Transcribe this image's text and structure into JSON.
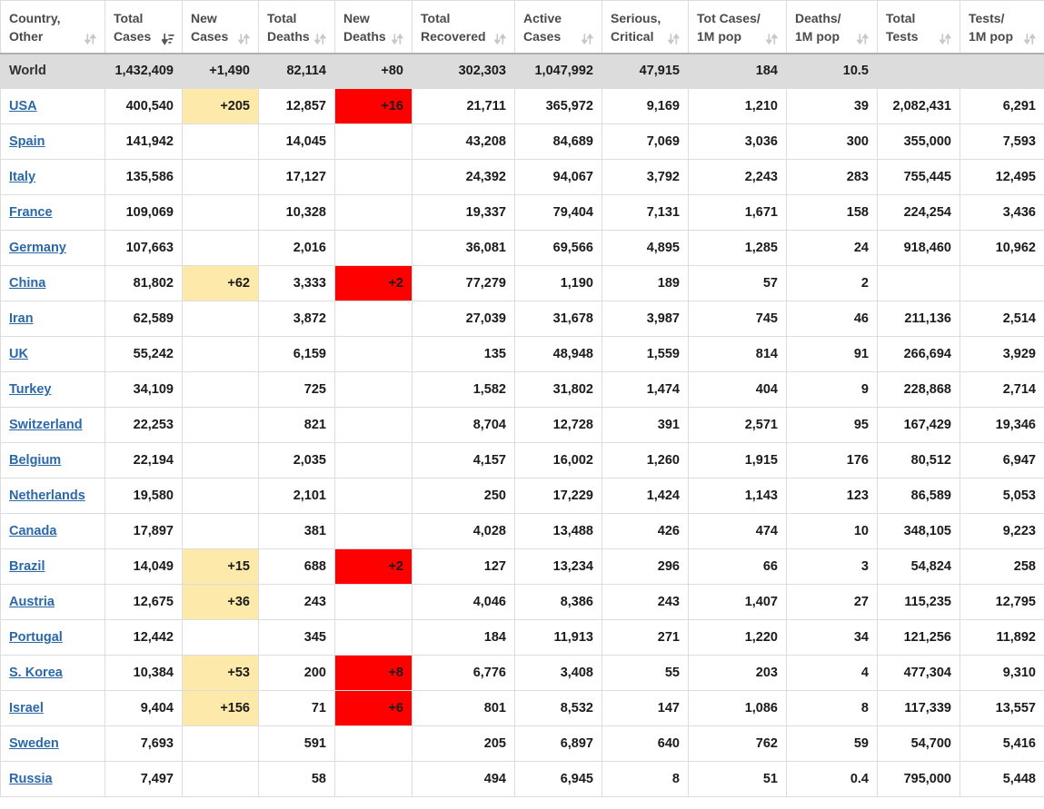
{
  "table": {
    "columns": [
      {
        "label_line1": "Country,",
        "label_line2": "Other",
        "sort": "both",
        "key": "country"
      },
      {
        "label_line1": "Total",
        "label_line2": "Cases",
        "sort": "desc",
        "key": "total_cases"
      },
      {
        "label_line1": "New",
        "label_line2": "Cases",
        "sort": "both",
        "key": "new_cases"
      },
      {
        "label_line1": "Total",
        "label_line2": "Deaths",
        "sort": "both",
        "key": "total_deaths"
      },
      {
        "label_line1": "New",
        "label_line2": "Deaths",
        "sort": "both",
        "key": "new_deaths"
      },
      {
        "label_line1": "Total",
        "label_line2": "Recovered",
        "sort": "both",
        "key": "total_recovered"
      },
      {
        "label_line1": "Active",
        "label_line2": "Cases",
        "sort": "both",
        "key": "active_cases"
      },
      {
        "label_line1": "Serious,",
        "label_line2": "Critical",
        "sort": "both",
        "key": "serious_critical"
      },
      {
        "label_line1": "Tot Cases/",
        "label_line2": "1M pop",
        "sort": "both",
        "key": "tot_cases_per_1m"
      },
      {
        "label_line1": "Deaths/",
        "label_line2": "1M pop",
        "sort": "both",
        "key": "deaths_per_1m"
      },
      {
        "label_line1": "Total",
        "label_line2": "Tests",
        "sort": "both",
        "key": "total_tests"
      },
      {
        "label_line1": "Tests/",
        "label_line2": "1M pop",
        "sort": "both",
        "key": "tests_per_1m"
      }
    ],
    "world_row": {
      "country": "World",
      "total_cases": "1,432,409",
      "new_cases": "+1,490",
      "total_deaths": "82,114",
      "new_deaths": "+80",
      "total_recovered": "302,303",
      "active_cases": "1,047,992",
      "serious_critical": "47,915",
      "tot_cases_per_1m": "184",
      "deaths_per_1m": "10.5",
      "total_tests": "",
      "tests_per_1m": ""
    },
    "rows": [
      {
        "country": "USA",
        "total_cases": "400,540",
        "new_cases": "+205",
        "total_deaths": "12,857",
        "new_deaths": "+16",
        "total_recovered": "21,711",
        "active_cases": "365,972",
        "serious_critical": "9,169",
        "tot_cases_per_1m": "1,210",
        "deaths_per_1m": "39",
        "total_tests": "2,082,431",
        "tests_per_1m": "6,291"
      },
      {
        "country": "Spain",
        "total_cases": "141,942",
        "new_cases": "",
        "total_deaths": "14,045",
        "new_deaths": "",
        "total_recovered": "43,208",
        "active_cases": "84,689",
        "serious_critical": "7,069",
        "tot_cases_per_1m": "3,036",
        "deaths_per_1m": "300",
        "total_tests": "355,000",
        "tests_per_1m": "7,593"
      },
      {
        "country": "Italy",
        "total_cases": "135,586",
        "new_cases": "",
        "total_deaths": "17,127",
        "new_deaths": "",
        "total_recovered": "24,392",
        "active_cases": "94,067",
        "serious_critical": "3,792",
        "tot_cases_per_1m": "2,243",
        "deaths_per_1m": "283",
        "total_tests": "755,445",
        "tests_per_1m": "12,495"
      },
      {
        "country": "France",
        "total_cases": "109,069",
        "new_cases": "",
        "total_deaths": "10,328",
        "new_deaths": "",
        "total_recovered": "19,337",
        "active_cases": "79,404",
        "serious_critical": "7,131",
        "tot_cases_per_1m": "1,671",
        "deaths_per_1m": "158",
        "total_tests": "224,254",
        "tests_per_1m": "3,436"
      },
      {
        "country": "Germany",
        "total_cases": "107,663",
        "new_cases": "",
        "total_deaths": "2,016",
        "new_deaths": "",
        "total_recovered": "36,081",
        "active_cases": "69,566",
        "serious_critical": "4,895",
        "tot_cases_per_1m": "1,285",
        "deaths_per_1m": "24",
        "total_tests": "918,460",
        "tests_per_1m": "10,962"
      },
      {
        "country": "China",
        "total_cases": "81,802",
        "new_cases": "+62",
        "total_deaths": "3,333",
        "new_deaths": "+2",
        "total_recovered": "77,279",
        "active_cases": "1,190",
        "serious_critical": "189",
        "tot_cases_per_1m": "57",
        "deaths_per_1m": "2",
        "total_tests": "",
        "tests_per_1m": ""
      },
      {
        "country": "Iran",
        "total_cases": "62,589",
        "new_cases": "",
        "total_deaths": "3,872",
        "new_deaths": "",
        "total_recovered": "27,039",
        "active_cases": "31,678",
        "serious_critical": "3,987",
        "tot_cases_per_1m": "745",
        "deaths_per_1m": "46",
        "total_tests": "211,136",
        "tests_per_1m": "2,514"
      },
      {
        "country": "UK",
        "total_cases": "55,242",
        "new_cases": "",
        "total_deaths": "6,159",
        "new_deaths": "",
        "total_recovered": "135",
        "active_cases": "48,948",
        "serious_critical": "1,559",
        "tot_cases_per_1m": "814",
        "deaths_per_1m": "91",
        "total_tests": "266,694",
        "tests_per_1m": "3,929"
      },
      {
        "country": "Turkey",
        "total_cases": "34,109",
        "new_cases": "",
        "total_deaths": "725",
        "new_deaths": "",
        "total_recovered": "1,582",
        "active_cases": "31,802",
        "serious_critical": "1,474",
        "tot_cases_per_1m": "404",
        "deaths_per_1m": "9",
        "total_tests": "228,868",
        "tests_per_1m": "2,714"
      },
      {
        "country": "Switzerland",
        "total_cases": "22,253",
        "new_cases": "",
        "total_deaths": "821",
        "new_deaths": "",
        "total_recovered": "8,704",
        "active_cases": "12,728",
        "serious_critical": "391",
        "tot_cases_per_1m": "2,571",
        "deaths_per_1m": "95",
        "total_tests": "167,429",
        "tests_per_1m": "19,346"
      },
      {
        "country": "Belgium",
        "total_cases": "22,194",
        "new_cases": "",
        "total_deaths": "2,035",
        "new_deaths": "",
        "total_recovered": "4,157",
        "active_cases": "16,002",
        "serious_critical": "1,260",
        "tot_cases_per_1m": "1,915",
        "deaths_per_1m": "176",
        "total_tests": "80,512",
        "tests_per_1m": "6,947"
      },
      {
        "country": "Netherlands",
        "total_cases": "19,580",
        "new_cases": "",
        "total_deaths": "2,101",
        "new_deaths": "",
        "total_recovered": "250",
        "active_cases": "17,229",
        "serious_critical": "1,424",
        "tot_cases_per_1m": "1,143",
        "deaths_per_1m": "123",
        "total_tests": "86,589",
        "tests_per_1m": "5,053"
      },
      {
        "country": "Canada",
        "total_cases": "17,897",
        "new_cases": "",
        "total_deaths": "381",
        "new_deaths": "",
        "total_recovered": "4,028",
        "active_cases": "13,488",
        "serious_critical": "426",
        "tot_cases_per_1m": "474",
        "deaths_per_1m": "10",
        "total_tests": "348,105",
        "tests_per_1m": "9,223"
      },
      {
        "country": "Brazil",
        "total_cases": "14,049",
        "new_cases": "+15",
        "total_deaths": "688",
        "new_deaths": "+2",
        "total_recovered": "127",
        "active_cases": "13,234",
        "serious_critical": "296",
        "tot_cases_per_1m": "66",
        "deaths_per_1m": "3",
        "total_tests": "54,824",
        "tests_per_1m": "258"
      },
      {
        "country": "Austria",
        "total_cases": "12,675",
        "new_cases": "+36",
        "total_deaths": "243",
        "new_deaths": "",
        "total_recovered": "4,046",
        "active_cases": "8,386",
        "serious_critical": "243",
        "tot_cases_per_1m": "1,407",
        "deaths_per_1m": "27",
        "total_tests": "115,235",
        "tests_per_1m": "12,795"
      },
      {
        "country": "Portugal",
        "total_cases": "12,442",
        "new_cases": "",
        "total_deaths": "345",
        "new_deaths": "",
        "total_recovered": "184",
        "active_cases": "11,913",
        "serious_critical": "271",
        "tot_cases_per_1m": "1,220",
        "deaths_per_1m": "34",
        "total_tests": "121,256",
        "tests_per_1m": "11,892"
      },
      {
        "country": "S. Korea",
        "total_cases": "10,384",
        "new_cases": "+53",
        "total_deaths": "200",
        "new_deaths": "+8",
        "total_recovered": "6,776",
        "active_cases": "3,408",
        "serious_critical": "55",
        "tot_cases_per_1m": "203",
        "deaths_per_1m": "4",
        "total_tests": "477,304",
        "tests_per_1m": "9,310"
      },
      {
        "country": "Israel",
        "total_cases": "9,404",
        "new_cases": "+156",
        "total_deaths": "71",
        "new_deaths": "+6",
        "total_recovered": "801",
        "active_cases": "8,532",
        "serious_critical": "147",
        "tot_cases_per_1m": "1,086",
        "deaths_per_1m": "8",
        "total_tests": "117,339",
        "tests_per_1m": "13,557"
      },
      {
        "country": "Sweden",
        "total_cases": "7,693",
        "new_cases": "",
        "total_deaths": "591",
        "new_deaths": "",
        "total_recovered": "205",
        "active_cases": "6,897",
        "serious_critical": "640",
        "tot_cases_per_1m": "762",
        "deaths_per_1m": "59",
        "total_tests": "54,700",
        "tests_per_1m": "5,416"
      },
      {
        "country": "Russia",
        "total_cases": "7,497",
        "new_cases": "",
        "total_deaths": "58",
        "new_deaths": "",
        "total_recovered": "494",
        "active_cases": "6,945",
        "serious_critical": "8",
        "tot_cases_per_1m": "51",
        "deaths_per_1m": "0.4",
        "total_tests": "795,000",
        "tests_per_1m": "5,448"
      }
    ]
  },
  "colors": {
    "new_cases_highlight": "#fde9a9",
    "new_deaths_highlight": "#ff0000",
    "link": "#2b68a8",
    "world_row_bg": "#dcdcdc",
    "border": "#dddddd",
    "header_text": "#4a4a4a"
  },
  "icons": {
    "sort_both": "sort-both-icon",
    "sort_desc": "sort-descending-icon"
  }
}
